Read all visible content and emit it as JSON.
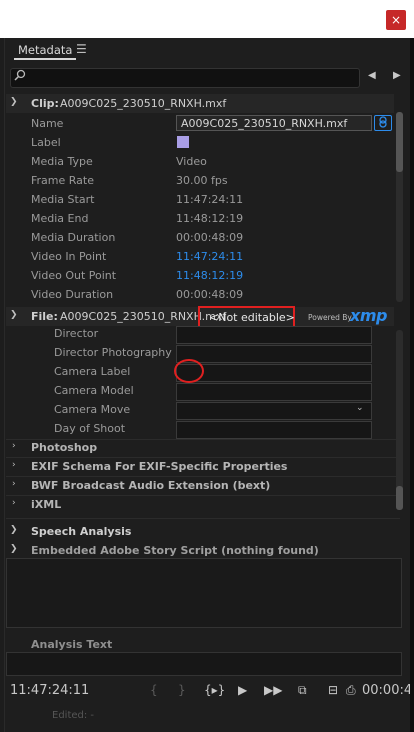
{
  "window": {
    "close_glyph": "×"
  },
  "panel": {
    "tab_label": "Metadata",
    "menu_glyph": "☰",
    "search": {
      "placeholder": "",
      "icon": "search-icon"
    },
    "nav": {
      "prev_glyph": "◀",
      "next_glyph": "▶"
    }
  },
  "clip_section": {
    "label": "Clip:",
    "value": "A009C025_230510_RNXH.mxf",
    "rows": [
      {
        "label": "Name",
        "value": "A009C025_230510_RNXH.mxf"
      },
      {
        "label": "Label",
        "value": "",
        "swatch_color": "#a99ee6"
      },
      {
        "label": "Media Type",
        "value": "Video"
      },
      {
        "label": "Frame Rate",
        "value": "30.00 fps"
      },
      {
        "label": "Media Start",
        "value": "11:47:24:11"
      },
      {
        "label": "Media End",
        "value": "11:48:12:19"
      },
      {
        "label": "Media Duration",
        "value": "00:00:48:09"
      },
      {
        "label": "Video In Point",
        "value": "11:47:24:11"
      },
      {
        "label": "Video Out Point",
        "value": "11:48:12:19"
      },
      {
        "label": "Video Duration",
        "value": "00:00:48:09"
      }
    ],
    "link_glyph": "🔗"
  },
  "file_section": {
    "label": "File:",
    "value": "A009C025_230510_RNXH.mxf",
    "not_editable": "<Not editable>",
    "powered_by": "Powered By",
    "xmp_logo": "xmp",
    "rows": [
      {
        "label": "Director"
      },
      {
        "label": "Director Photography"
      },
      {
        "label": "Camera Label"
      },
      {
        "label": "Camera Model"
      },
      {
        "label": "Camera Move"
      },
      {
        "label": "Day of Shoot"
      }
    ],
    "dropdown_glyph": "⌄"
  },
  "collapsed_sections": [
    {
      "label": "Photoshop"
    },
    {
      "label": "EXIF Schema For EXIF-Specific Properties"
    },
    {
      "label": "BWF Broadcast Audio Extension (bext)"
    },
    {
      "label": "iXML"
    }
  ],
  "speech": {
    "label": "Speech Analysis",
    "embedded": "Embedded Adobe Story Script (nothing found)",
    "analysis_text": "Analysis Text"
  },
  "footer": {
    "timecode_left": "11:47:24:11",
    "timecode_right": "00:00:4",
    "edited": "Edited: -",
    "controls": {
      "mark_in": "{",
      "mark_out": "}",
      "goto_in_out": "{▸}",
      "play": "▶",
      "play_in_out": "▶▶",
      "insert": "⧉",
      "overwrite": "⊟",
      "export": "⎙"
    }
  },
  "colors": {
    "accent": "#2d8ceb",
    "highlight": "#e02020",
    "label_swatch": "#a99ee6"
  }
}
